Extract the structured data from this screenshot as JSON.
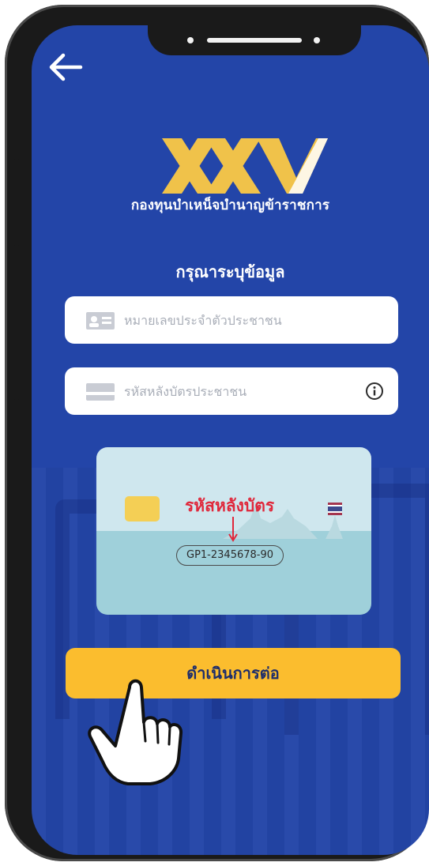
{
  "header": {
    "back_icon": "arrow-left-icon"
  },
  "brand": {
    "logo_text": "XXV",
    "org_name": "กองทุนบำเหน็จบำนาญข้าราชการ"
  },
  "form": {
    "prompt": "กรุณาระบุข้อมูล",
    "id_number": {
      "placeholder": "หมายเลขประจำตัวประชาชน",
      "icon": "id-card-icon"
    },
    "card_back_code": {
      "placeholder": "รหัสหลังบัตรประชาชน",
      "icon": "card-icon",
      "info_icon": "info-icon"
    }
  },
  "card_example": {
    "title": "รหัสหลังบัตร",
    "code": "GP1-2345678-90"
  },
  "cta": {
    "label": "ดำเนินการต่อ"
  },
  "colors": {
    "screen_bg": "#2345a8",
    "button": "#fbbd2e",
    "logo_gold": "#f0c24a",
    "card_title": "#e0283b"
  }
}
